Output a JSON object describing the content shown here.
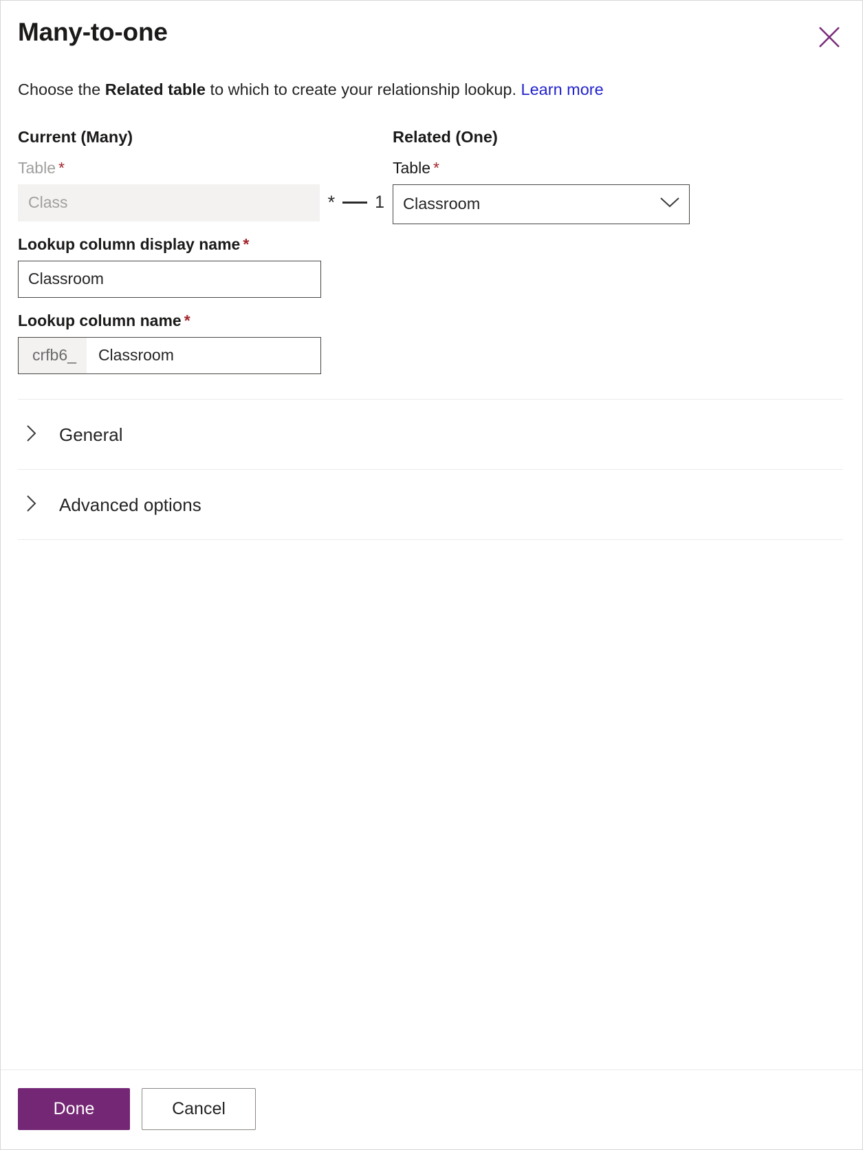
{
  "dialog": {
    "title": "Many-to-one",
    "close_icon": "close-icon",
    "description_prefix": "Choose the ",
    "description_bold": "Related table",
    "description_suffix": " to which to create your relationship lookup. ",
    "learn_more": "Learn more"
  },
  "current_many": {
    "heading": "Current (Many)",
    "table_label": "Table",
    "required_mark": "*",
    "table_value": "Class",
    "table_readonly": true
  },
  "related_one": {
    "heading": "Related (One)",
    "table_label": "Table",
    "required_mark": "*",
    "table_value": "Classroom",
    "dropdown_icon": "chevron-down-icon"
  },
  "relationship_indicator": {
    "many_symbol": "*",
    "one_symbol": "1"
  },
  "lookup_display_name": {
    "label": "Lookup column display name",
    "required_mark": "*",
    "value": "Classroom"
  },
  "lookup_name": {
    "label": "Lookup column name",
    "required_mark": "*",
    "prefix": "crfb6_",
    "value": "Classroom"
  },
  "sections": [
    {
      "label": "General",
      "icon": "chevron-right-icon",
      "expanded": false
    },
    {
      "label": "Advanced options",
      "icon": "chevron-right-icon",
      "expanded": false
    }
  ],
  "footer": {
    "done_label": "Done",
    "cancel_label": "Cancel"
  },
  "colors": {
    "accent": "#742774",
    "link": "#2222cc",
    "required": "#a4262c",
    "readonly_bg": "#f3f2f1",
    "border": "#484644",
    "divider": "#edebe9"
  }
}
